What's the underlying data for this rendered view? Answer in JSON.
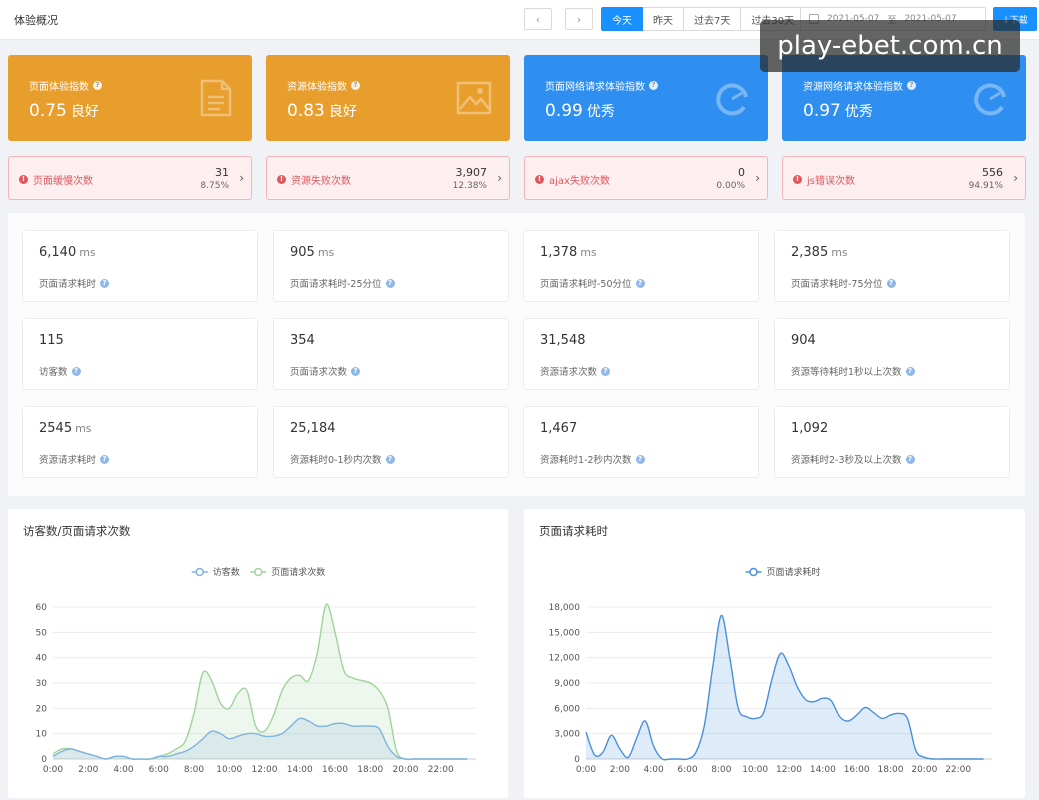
{
  "header": {
    "title": "体验概况",
    "prev_label": "‹",
    "next_label": "›",
    "ranges": [
      "今天",
      "昨天",
      "过去7天",
      "过去30天"
    ],
    "date_start": "2021-05-07",
    "date_sep": "至",
    "date_end": "2021-05-07",
    "download_label": "↓下载"
  },
  "index_cards": [
    {
      "title": "页面体验指数",
      "value": "0.75",
      "label": "良好",
      "color": "#e89e2c",
      "icon": "document-icon"
    },
    {
      "title": "资源体验指数",
      "value": "0.83",
      "label": "良好",
      "color": "#e89e2c",
      "icon": "image-icon"
    },
    {
      "title": "页面网络请求体验指数",
      "value": "0.99",
      "label": "优秀",
      "color": "#2f8ff0",
      "icon": "gauge-icon"
    },
    {
      "title": "资源网络请求体验指数",
      "value": "0.97",
      "label": "优秀",
      "color": "#2f8ff0",
      "icon": "gauge-icon"
    }
  ],
  "alerts": [
    {
      "label": "页面缓慢次数",
      "count": "31",
      "pct": "8.75%"
    },
    {
      "label": "资源失败次数",
      "count": "3,907",
      "pct": "12.38%"
    },
    {
      "label": "ajax失败次数",
      "count": "0",
      "pct": "0.00%"
    },
    {
      "label": "js错误次数",
      "count": "556",
      "pct": "94.91%"
    }
  ],
  "metrics": [
    {
      "value": "6,140",
      "unit": "ms",
      "label": "页面请求耗时"
    },
    {
      "value": "905",
      "unit": "ms",
      "label": "页面请求耗时-25分位"
    },
    {
      "value": "1,378",
      "unit": "ms",
      "label": "页面请求耗时-50分位"
    },
    {
      "value": "2,385",
      "unit": "ms",
      "label": "页面请求耗时-75分位"
    },
    {
      "value": "115",
      "unit": "",
      "label": "访客数"
    },
    {
      "value": "354",
      "unit": "",
      "label": "页面请求次数"
    },
    {
      "value": "31,548",
      "unit": "",
      "label": "资源请求次数"
    },
    {
      "value": "904",
      "unit": "",
      "label": "资源等待耗时1秒以上次数"
    },
    {
      "value": "2545",
      "unit": "ms",
      "label": "资源请求耗时"
    },
    {
      "value": "25,184",
      "unit": "",
      "label": "资源耗时0-1秒内次数"
    },
    {
      "value": "1,467",
      "unit": "",
      "label": "资源耗时1-2秒内次数"
    },
    {
      "value": "1,092",
      "unit": "",
      "label": "资源耗时2-3秒及以上次数"
    }
  ],
  "watermark": "play-ebet.com.cn",
  "chart_data": [
    {
      "type": "area",
      "title": "访客数/页面请求次数",
      "x": [
        0,
        0.5,
        1,
        1.5,
        2,
        2.5,
        3,
        3.5,
        4,
        4.5,
        5,
        5.5,
        6,
        6.5,
        7,
        7.5,
        8,
        8.5,
        9,
        9.5,
        10,
        10.5,
        11,
        11.5,
        12,
        12.5,
        13,
        13.5,
        14,
        14.5,
        15,
        15.5,
        16,
        16.5,
        17,
        17.5,
        18,
        18.5,
        19,
        19.5,
        20,
        20.5,
        21,
        21.5,
        22,
        22.5,
        23,
        23.5
      ],
      "x_ticks": [
        "0:00",
        "2:00",
        "4:00",
        "6:00",
        "8:00",
        "10:00",
        "12:00",
        "14:00",
        "16:00",
        "18:00",
        "20:00",
        "22:00"
      ],
      "ylim": [
        0,
        60
      ],
      "y_ticks": [
        0,
        10,
        20,
        30,
        40,
        50,
        60
      ],
      "legend": "top-center",
      "series": [
        {
          "name": "访客数",
          "color": "#7fb3e0",
          "values": [
            1,
            3,
            4,
            3,
            2,
            1,
            0,
            1,
            1,
            0,
            0,
            0,
            1,
            1,
            2,
            3,
            5,
            8,
            11,
            10,
            8,
            9,
            10,
            10,
            9,
            9,
            10,
            13,
            16,
            15,
            13,
            13,
            14,
            14,
            13,
            13,
            13,
            12,
            5,
            1,
            0,
            0,
            0,
            0,
            0,
            0,
            0,
            0
          ]
        },
        {
          "name": "页面请求次数",
          "color": "#9fd49a",
          "values": [
            2,
            4,
            4,
            3,
            2,
            1,
            0,
            1,
            1,
            0,
            0,
            0,
            1,
            2,
            4,
            7,
            18,
            34,
            31,
            22,
            20,
            26,
            27,
            13,
            11,
            17,
            27,
            32,
            33,
            31,
            42,
            61,
            50,
            35,
            32,
            31,
            30,
            27,
            20,
            3,
            0,
            0,
            0,
            0,
            0,
            0,
            0,
            0
          ]
        }
      ]
    },
    {
      "type": "area",
      "title": "页面请求耗时",
      "x": [
        0,
        0.5,
        1,
        1.5,
        2,
        2.5,
        3,
        3.5,
        4,
        4.5,
        5,
        5.5,
        6,
        6.5,
        7,
        7.5,
        8,
        8.5,
        9,
        9.5,
        10,
        10.5,
        11,
        11.5,
        12,
        12.5,
        13,
        13.5,
        14,
        14.5,
        15,
        15.5,
        16,
        16.5,
        17,
        17.5,
        18,
        18.5,
        19,
        19.5,
        20,
        20.5,
        21,
        21.5,
        22,
        22.5,
        23,
        23.5
      ],
      "x_ticks": [
        "0:00",
        "2:00",
        "4:00",
        "6:00",
        "8:00",
        "10:00",
        "12:00",
        "14:00",
        "16:00",
        "18:00",
        "20:00",
        "22:00"
      ],
      "ylim": [
        0,
        18000
      ],
      "y_ticks": [
        "0",
        "3,000",
        "6,000",
        "9,000",
        "12,000",
        "15,000",
        "18,000"
      ],
      "legend": "top-center",
      "series": [
        {
          "name": "页面请求耗时",
          "color": "#4a90d9",
          "values": [
            3200,
            500,
            800,
            2800,
            1200,
            200,
            2500,
            4500,
            1500,
            0,
            0,
            0,
            0,
            800,
            4000,
            11000,
            17000,
            12000,
            6000,
            5000,
            4800,
            5500,
            9500,
            12500,
            11000,
            8500,
            7000,
            6800,
            7200,
            6900,
            5000,
            4500,
            5200,
            6100,
            5500,
            4800,
            5200,
            5400,
            4800,
            1000,
            200,
            0,
            0,
            0,
            0,
            0,
            0,
            0
          ]
        }
      ]
    }
  ]
}
